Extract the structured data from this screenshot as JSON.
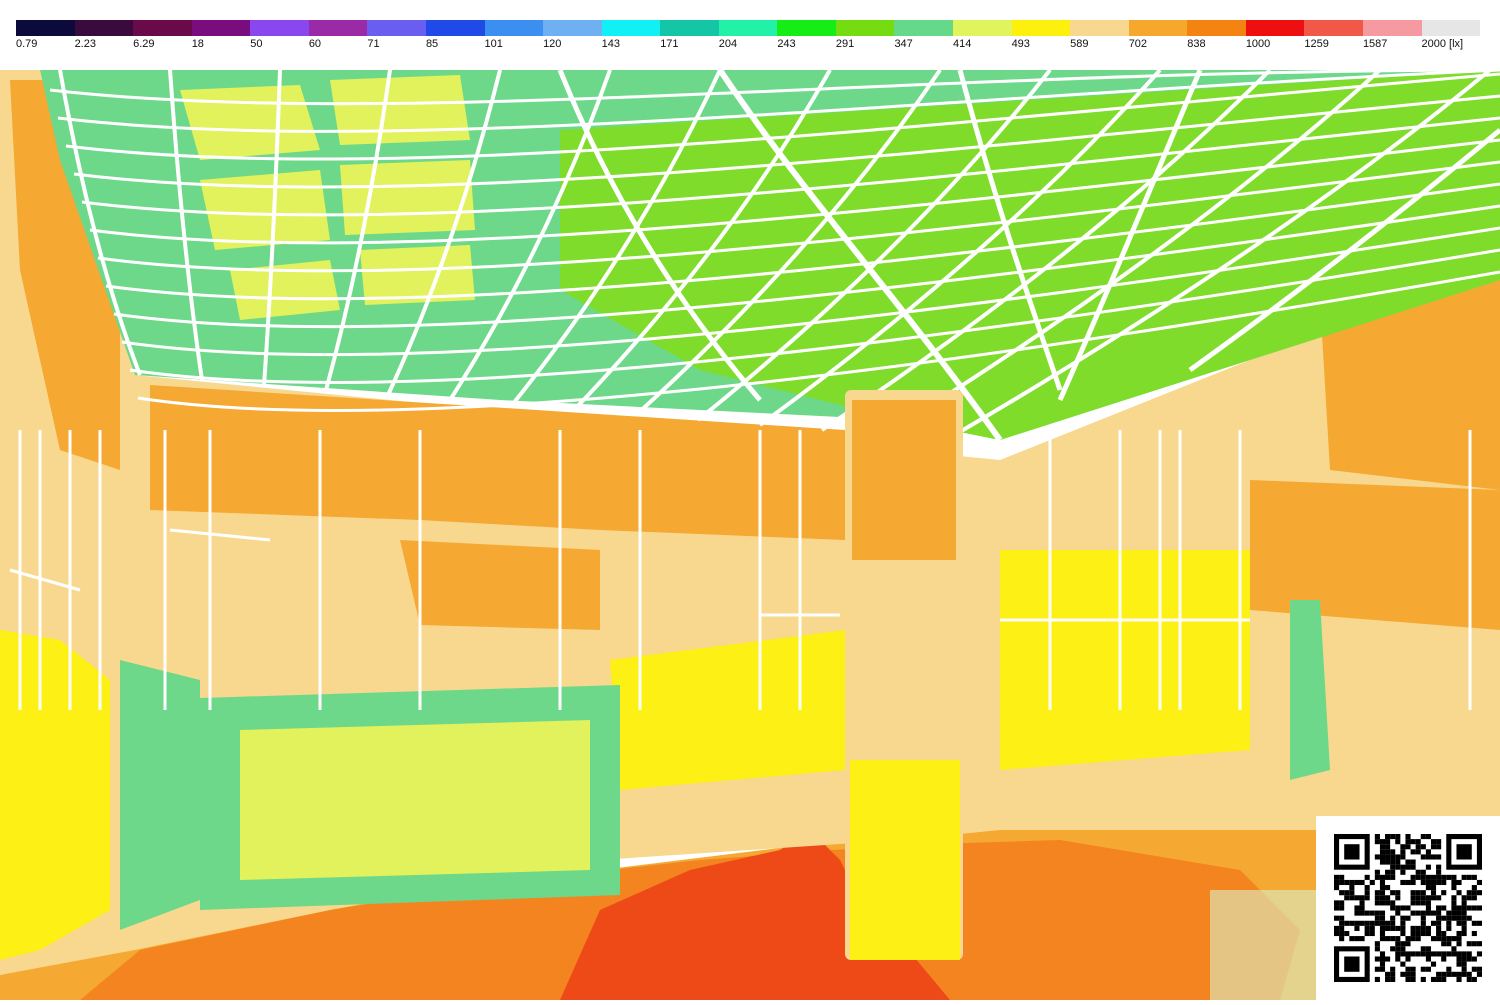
{
  "legend": {
    "unit": "[lx]",
    "levels": [
      {
        "label": "0.79",
        "color": "#0b0a3a"
      },
      {
        "label": "2.23",
        "color": "#3a0a3e"
      },
      {
        "label": "6.29",
        "color": "#6a0a48"
      },
      {
        "label": "18",
        "color": "#7a0d7e"
      },
      {
        "label": "50",
        "color": "#8a46ef"
      },
      {
        "label": "60",
        "color": "#9a2aa6"
      },
      {
        "label": "71",
        "color": "#6a5ef0"
      },
      {
        "label": "85",
        "color": "#1f4ae8"
      },
      {
        "label": "101",
        "color": "#3b8ff0"
      },
      {
        "label": "120",
        "color": "#6fb0f2"
      },
      {
        "label": "143",
        "color": "#11f0f4"
      },
      {
        "label": "171",
        "color": "#14c6a6"
      },
      {
        "label": "204",
        "color": "#22f2a8"
      },
      {
        "label": "243",
        "color": "#14ee16"
      },
      {
        "label": "291",
        "color": "#74dc10"
      },
      {
        "label": "347",
        "color": "#66d88a"
      },
      {
        "label": "414",
        "color": "#e0f45e"
      },
      {
        "label": "493",
        "color": "#fcf00c"
      },
      {
        "label": "589",
        "color": "#f8d88e"
      },
      {
        "label": "702",
        "color": "#f5a82c"
      },
      {
        "label": "838",
        "color": "#f48412"
      },
      {
        "label": "1000",
        "color": "#ee1010"
      },
      {
        "label": "1259",
        "color": "#f25848"
      },
      {
        "label": "1587",
        "color": "#f49aa0"
      },
      {
        "label": "2000 [lx]",
        "color": "#e6e6e6"
      }
    ]
  },
  "render": {
    "colors": {
      "ceiling": "#6dd88a",
      "ceiling_bright": "#7fdc2a",
      "ceiling_yellow": "#e2f25c",
      "grid_lines": "#ffffff",
      "wall": "#f8d88e",
      "wall_orange": "#f5a832",
      "wall_yellow": "#fcf014",
      "panel_green": "#6dd88a",
      "panel_yellow": "#e2f25c",
      "floor": "#f5a832",
      "floor_orange": "#f48420",
      "floor_red": "#ee4a18"
    }
  },
  "qr_code": {
    "icon": "qr-code-icon"
  }
}
